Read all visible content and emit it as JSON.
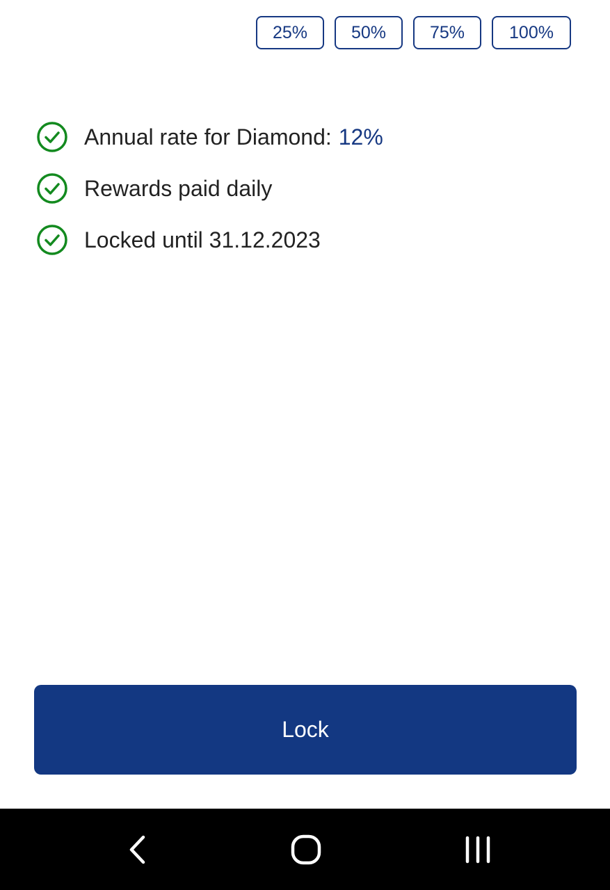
{
  "percent_options": [
    "25%",
    "50%",
    "75%",
    "100%"
  ],
  "features": [
    {
      "label": "Annual rate for Diamond:",
      "value": "12%",
      "icon": "check-circle-icon"
    },
    {
      "label": "Rewards paid daily",
      "icon": "check-circle-icon"
    },
    {
      "label": "Locked until 31.12.2023",
      "icon": "check-circle-icon"
    }
  ],
  "lock_button": {
    "label": "Lock"
  },
  "nav_bar": {
    "back_icon": "back-chevron-icon",
    "home_icon": "home-icon",
    "recents_icon": "recents-icon"
  },
  "colors": {
    "accent": "#163882",
    "check_green": "#138a1f",
    "text": "#222222",
    "nav_background": "#000000"
  }
}
